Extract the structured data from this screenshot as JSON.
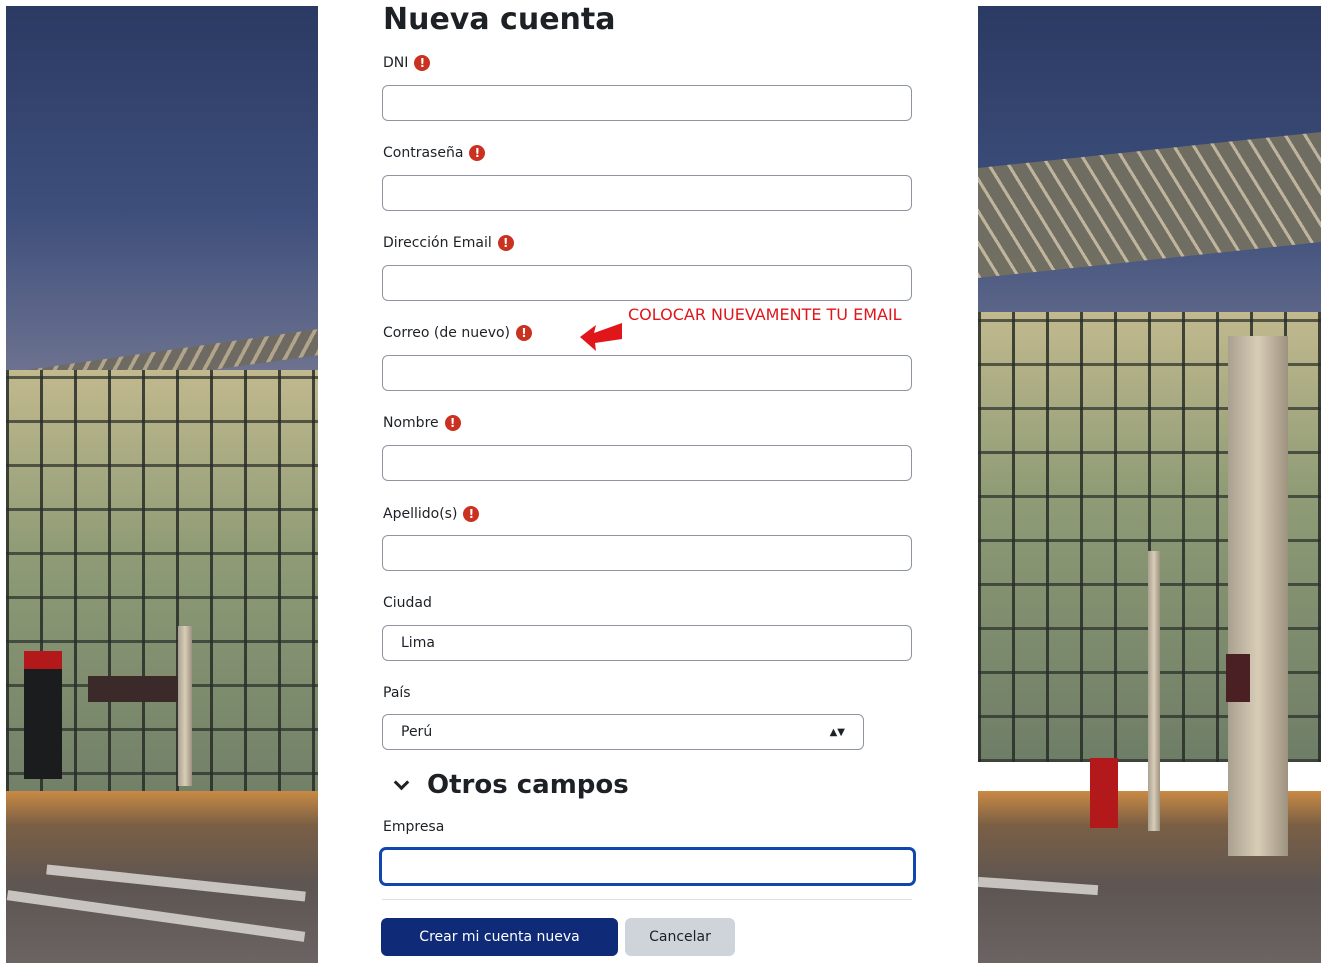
{
  "form": {
    "title": "Nueva cuenta",
    "fields": [
      {
        "label": "DNI",
        "required": true,
        "value": ""
      },
      {
        "label": "Contraseña",
        "required": true,
        "value": ""
      },
      {
        "label": "Dirección Email",
        "required": true,
        "value": ""
      },
      {
        "label": "Correo (de nuevo)",
        "required": true,
        "value": ""
      },
      {
        "label": "Nombre",
        "required": true,
        "value": ""
      },
      {
        "label": "Apellido(s)",
        "required": true,
        "value": ""
      },
      {
        "label": "Ciudad",
        "required": false,
        "value": "Lima"
      }
    ],
    "country": {
      "label": "País",
      "value": "Perú"
    },
    "other_section": {
      "title": "Otros campos",
      "company": {
        "label": "Empresa",
        "value": ""
      }
    },
    "required_icon": "exclamation-circle-icon",
    "submit_label": "Crear mi cuenta nueva",
    "cancel_label": "Cancelar"
  },
  "annotation": {
    "text": "COLOCAR NUEVAMENTE TU EMAIL",
    "color": "#e0161b"
  },
  "colors": {
    "primary_button": "#0f2a77",
    "secondary_button": "#ced4da",
    "required_icon": "#ca3120",
    "focus_ring": "#0f47ad"
  }
}
